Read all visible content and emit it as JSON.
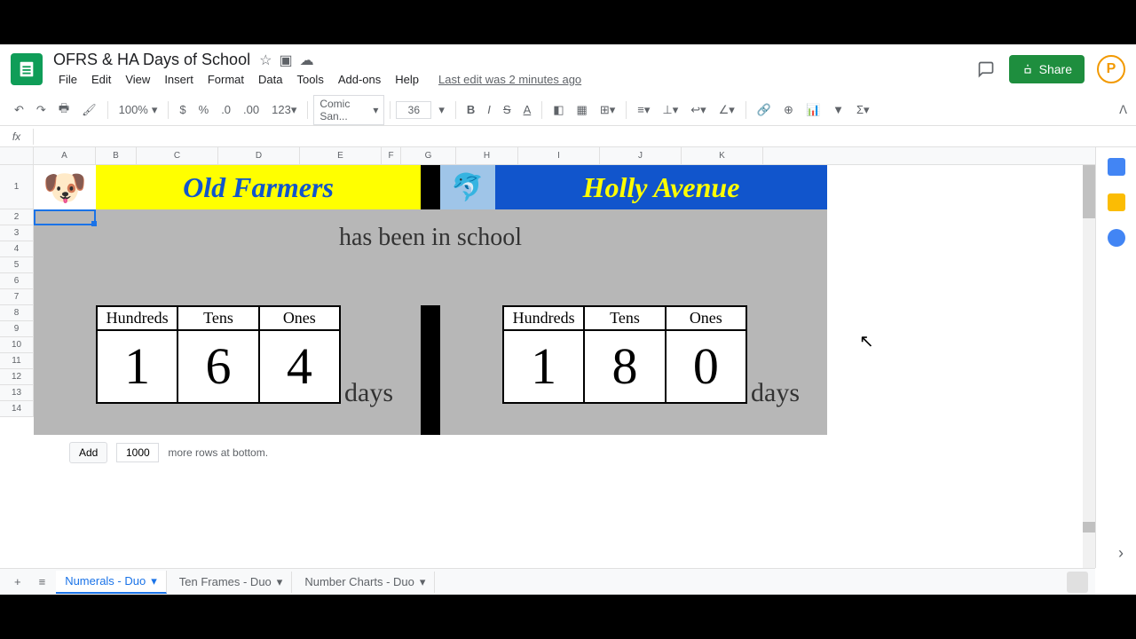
{
  "doc_title": "OFRS & HA Days of School",
  "menu": [
    "File",
    "Edit",
    "View",
    "Insert",
    "Format",
    "Data",
    "Tools",
    "Add-ons",
    "Help"
  ],
  "last_edit": "Last edit was 2 minutes ago",
  "share_label": "Share",
  "avatar_letter": "P",
  "toolbar": {
    "zoom": "100%",
    "font_name": "Comic San...",
    "font_size": "36",
    "number_format": "123"
  },
  "fx_label": "fx",
  "columns": [
    "A",
    "B",
    "C",
    "D",
    "E",
    "F",
    "G",
    "H",
    "I",
    "J",
    "K"
  ],
  "rows": [
    "1",
    "2",
    "3",
    "4",
    "5",
    "6",
    "7",
    "8",
    "9",
    "10",
    "11",
    "12",
    "13",
    "14"
  ],
  "content": {
    "left_banner": "Old Farmers",
    "right_banner": "Holly Avenue",
    "subtitle": "has been in school",
    "place_headers": [
      "Hundreds",
      "Tens",
      "Ones"
    ],
    "left_values": [
      "1",
      "6",
      "4"
    ],
    "right_values": [
      "1",
      "8",
      "0"
    ],
    "days_label": "days"
  },
  "add_rows": {
    "button": "Add",
    "value": "1000",
    "suffix": "more rows at bottom."
  },
  "sheet_tabs": [
    "Numerals - Duo",
    "Ten Frames - Duo",
    "Number Charts - Duo"
  ],
  "active_tab": 0,
  "chart_data": {
    "type": "table",
    "title": "Days of School place-value counters",
    "series": [
      {
        "name": "Old Farmers",
        "hundreds": 1,
        "tens": 6,
        "ones": 4,
        "total_days": 164
      },
      {
        "name": "Holly Avenue",
        "hundreds": 1,
        "tens": 8,
        "ones": 0,
        "total_days": 180
      }
    ]
  }
}
